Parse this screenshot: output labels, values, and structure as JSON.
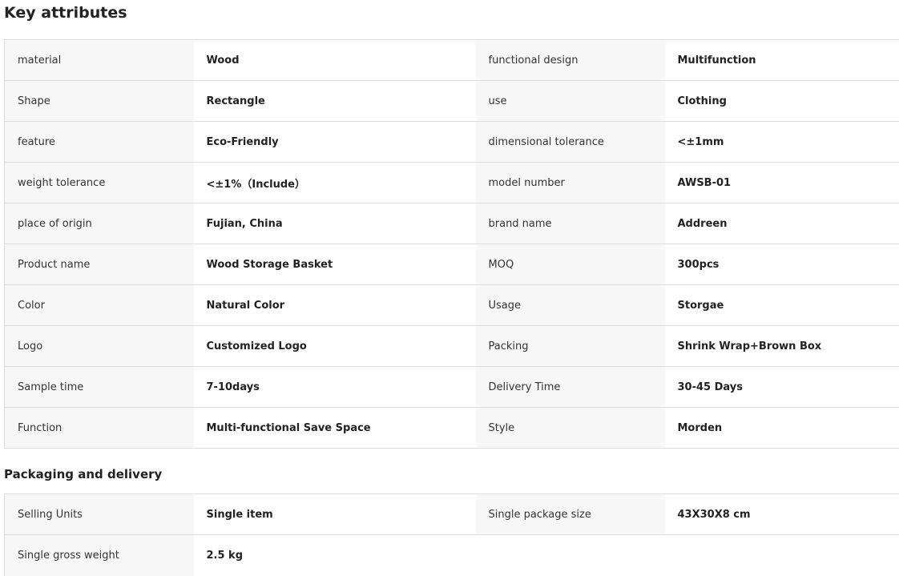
{
  "sections": {
    "key_attributes": {
      "title": "Key attributes",
      "rows": [
        {
          "k1": "material",
          "v1": "Wood",
          "k2": "functional design",
          "v2": "Multifunction"
        },
        {
          "k1": "Shape",
          "v1": "Rectangle",
          "k2": "use",
          "v2": "Clothing"
        },
        {
          "k1": "feature",
          "v1": "Eco-Friendly",
          "k2": "dimensional tolerance",
          "v2": "<±1mm"
        },
        {
          "k1": "weight tolerance",
          "v1": "<±1%（Include）",
          "k2": "model number",
          "v2": "AWSB-01"
        },
        {
          "k1": "place of origin",
          "v1": "Fujian, China",
          "k2": "brand name",
          "v2": "Addreen"
        },
        {
          "k1": "Product name",
          "v1": "Wood Storage Basket",
          "k2": "MOQ",
          "v2": "300pcs"
        },
        {
          "k1": "Color",
          "v1": "Natural Color",
          "k2": "Usage",
          "v2": "Storgae"
        },
        {
          "k1": "Logo",
          "v1": "Customized Logo",
          "k2": "Packing",
          "v2": "Shrink Wrap+Brown Box"
        },
        {
          "k1": "Sample time",
          "v1": "7-10days",
          "k2": "Delivery Time",
          "v2": "30-45 Days"
        },
        {
          "k1": "Function",
          "v1": "Multi-functional Save Space",
          "k2": "Style",
          "v2": "Morden"
        }
      ]
    },
    "packaging": {
      "title": "Packaging and delivery",
      "rows": [
        {
          "k1": "Selling Units",
          "v1": "Single item",
          "k2": "Single package size",
          "v2": "43X30X8 cm"
        },
        {
          "k1": "Single gross weight",
          "v1": "2.5 kg"
        }
      ]
    }
  }
}
